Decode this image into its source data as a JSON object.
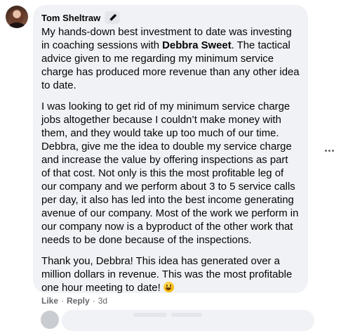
{
  "comment": {
    "author": "Tom Sheltraw",
    "author_badge_icon": "pencil-icon",
    "p1_before": "My hands-down best investment to date was investing in coaching sessions with ",
    "p1_mention": "Debbra Sweet",
    "p1_after": ". The tactical advice given to me regarding my minimum service charge has produced more revenue than any other idea to date.",
    "p2": "I was looking to get rid of my minimum service charge jobs altogether because I couldn’t make money with them, and they would take up too much of our time. Debbra, give me the idea to double my service charge and increase the value by offering inspections as part of that cost. Not only is this the most profitable leg of our company and we perform about 3 to 5 service calls per day, it also has led into the best income generating avenue of our company. Most of the work we perform in our company now is a byproduct of the other work that needs to be done because of the inspections.",
    "p3": "Thank you, Debbra! This idea has generated over a million dollars in revenue. This was the most profitable one hour meeting to date!",
    "emoji_icon": "grinning-face-icon"
  },
  "actions": {
    "like": "Like",
    "separator": "·",
    "reply": "Reply",
    "time": "3d"
  },
  "menu": {
    "more_icon": "more-options-icon"
  },
  "colors": {
    "bubble": "#f0f2f5",
    "text": "#050505",
    "secondary": "#65676b"
  }
}
